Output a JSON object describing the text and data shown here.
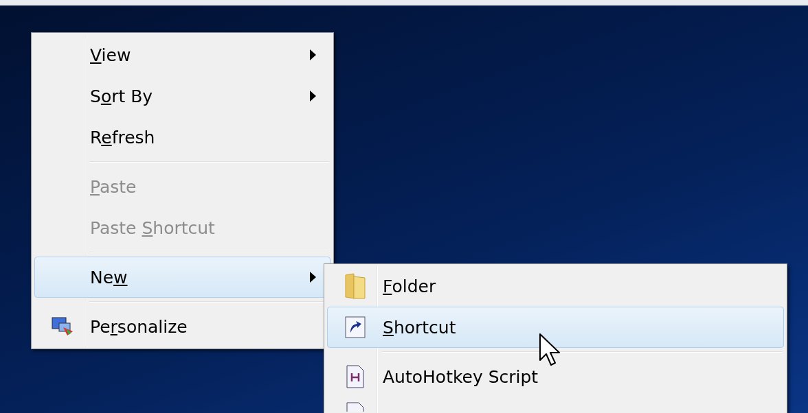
{
  "context_menu": {
    "items": [
      {
        "kind": "text",
        "key": "V",
        "post": "iew",
        "submenu": true,
        "disabled": false,
        "selected": false
      },
      {
        "kind": "text",
        "pre": "S",
        "key": "o",
        "post": "rt By",
        "submenu": true,
        "disabled": false,
        "selected": false
      },
      {
        "kind": "text",
        "pre": "R",
        "key": "e",
        "post": "fresh",
        "submenu": false,
        "disabled": false,
        "selected": false
      },
      {
        "kind": "separator"
      },
      {
        "kind": "text",
        "key": "P",
        "post": "aste",
        "submenu": false,
        "disabled": true,
        "selected": false
      },
      {
        "kind": "text",
        "pre": "Paste ",
        "key": "S",
        "post": "hortcut",
        "submenu": false,
        "disabled": true,
        "selected": false
      },
      {
        "kind": "separator"
      },
      {
        "kind": "text",
        "pre": "Ne",
        "key": "w",
        "submenu": true,
        "disabled": false,
        "selected": true
      },
      {
        "kind": "separator"
      },
      {
        "kind": "display",
        "pre": "Pe",
        "key": "r",
        "post": "sonalize",
        "submenu": false,
        "disabled": false,
        "selected": false
      }
    ]
  },
  "new_submenu": {
    "items": [
      {
        "kind": "folder",
        "key": "F",
        "post": "older",
        "submenu": false,
        "disabled": false,
        "selected": false
      },
      {
        "kind": "shortcut",
        "key": "S",
        "post": "hortcut",
        "submenu": false,
        "disabled": false,
        "selected": true
      },
      {
        "kind": "separator"
      },
      {
        "kind": "script",
        "pre": "AutoHotkey Script",
        "submenu": false,
        "disabled": false,
        "selected": false
      },
      {
        "kind": "blank",
        "selected": false
      }
    ]
  }
}
